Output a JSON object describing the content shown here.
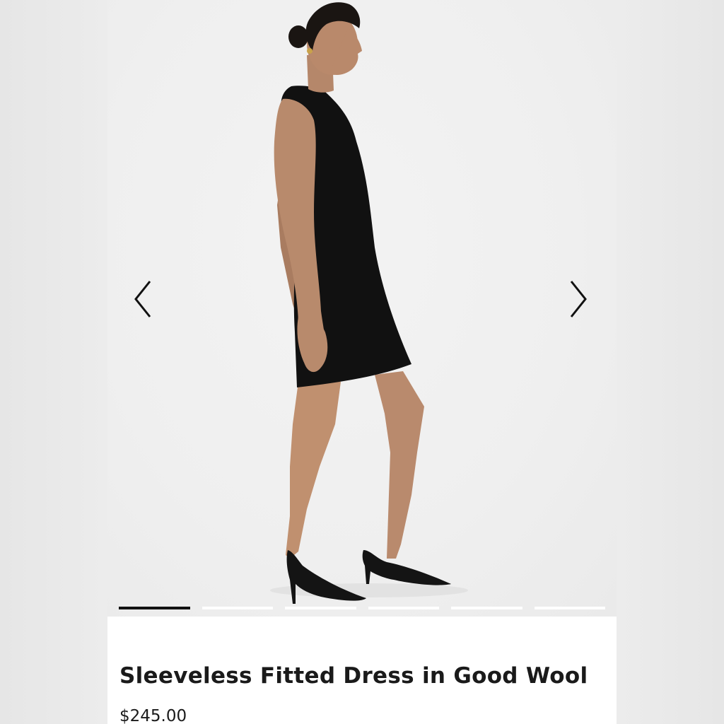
{
  "product": {
    "title": "Sleeveless Fitted Dress in Good Wool",
    "price": "$245.00"
  },
  "carousel": {
    "prev_icon": "chevron-left-icon",
    "next_icon": "chevron-right-icon",
    "slide_count": 6,
    "active_slide": 1
  },
  "colors": {
    "dress": "#111111",
    "background": "#efefef",
    "active_indicator": "#111111",
    "inactive_indicator": "#ffffff"
  }
}
